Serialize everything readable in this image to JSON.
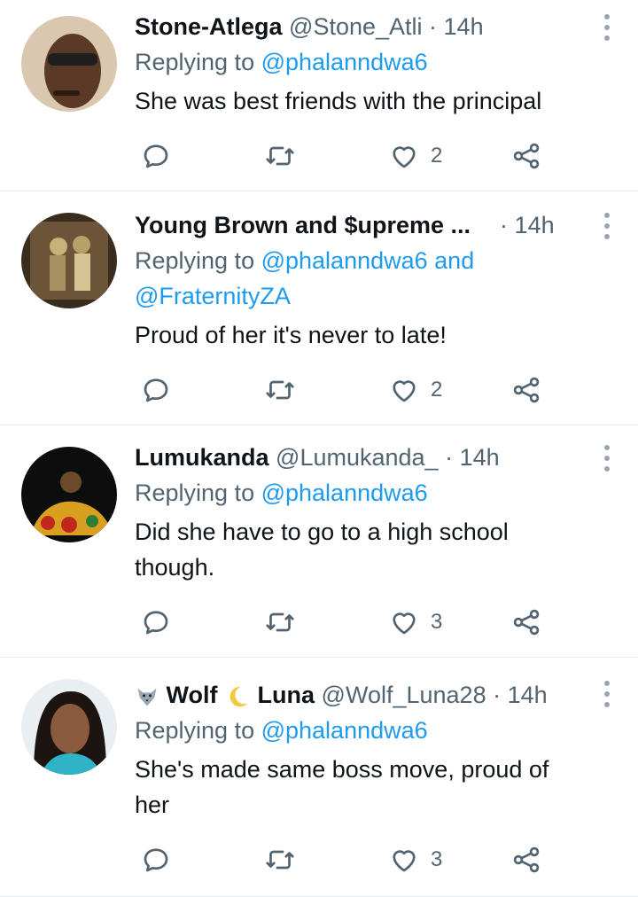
{
  "tweets": [
    {
      "name": "Stone-Atlega",
      "handle": "@Stone_Atli",
      "time": "14h",
      "replying_prefix": "Replying to ",
      "mention1": "@phalanndwa6",
      "mention_joiner": "",
      "mention2": "",
      "text_lines": [
        "She was best friends with the principal"
      ],
      "likes": "2"
    },
    {
      "name": "Young Brown and $upreme ...",
      "handle": "",
      "time": "14h",
      "replying_prefix": "Replying to ",
      "mention1": "@phalanndwa6",
      "mention_joiner": " and",
      "mention2": "@FraternityZA",
      "text_lines": [
        "Proud of her it's never to late!"
      ],
      "likes": "2"
    },
    {
      "name": "Lumukanda",
      "handle": "@Lumukanda_",
      "time": "14h",
      "replying_prefix": "Replying to ",
      "mention1": "@phalanndwa6",
      "mention_joiner": "",
      "mention2": "",
      "text_lines": [
        "Did she have to go to a high school",
        "though."
      ],
      "likes": "3"
    },
    {
      "name": "Wolf",
      "name2": "Luna",
      "handle": "@Wolf_Luna28",
      "time": "14h",
      "replying_prefix": "Replying to ",
      "mention1": "@phalanndwa6",
      "mention_joiner": "",
      "mention2": "",
      "text_lines": [
        "She's made same boss move, proud of",
        "her"
      ],
      "likes": "3"
    }
  ],
  "separator": " · ",
  "colors": {
    "link": "#1d9bf0",
    "muted": "#536471",
    "text": "#0f1419",
    "divider": "#e6ecf0"
  },
  "icons": [
    "reply-icon",
    "retweet-icon",
    "like-icon",
    "share-icon",
    "more-options-icon"
  ]
}
